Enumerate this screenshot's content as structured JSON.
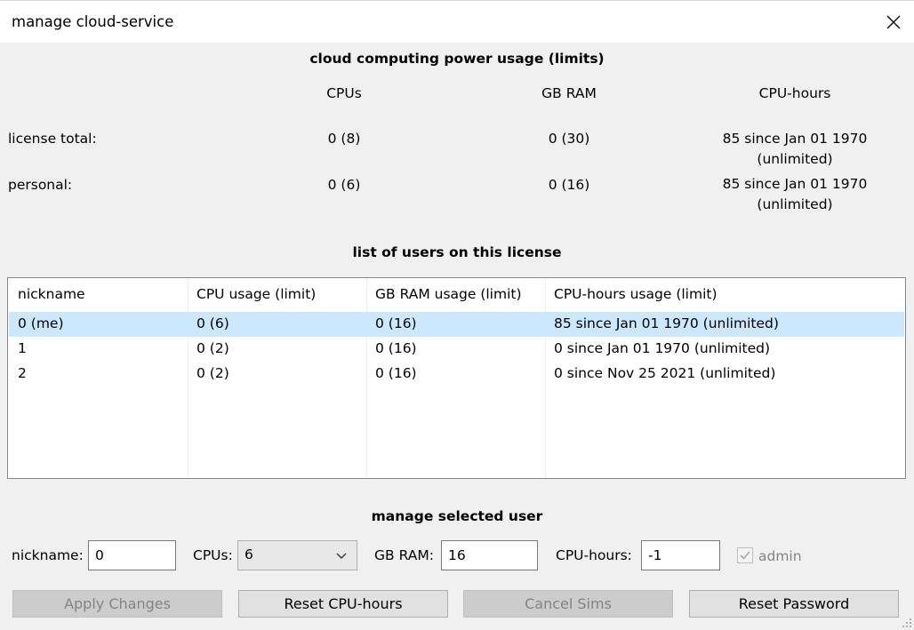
{
  "window": {
    "title": "manage cloud-service",
    "close_icon": "close-icon"
  },
  "usage": {
    "heading": "cloud computing power usage (limits)",
    "columns": {
      "cpus": "CPUs",
      "ram": "GB RAM",
      "hours": "CPU-hours"
    },
    "license_total": {
      "label": "license total:",
      "cpus": "0 (8)",
      "ram": "0 (30)",
      "hours_line1": "85 since Jan 01 1970",
      "hours_line2": "(unlimited)"
    },
    "personal": {
      "label": "personal:",
      "cpus": "0 (6)",
      "ram": "0 (16)",
      "hours_line1": "85 since Jan 01 1970",
      "hours_line2": "(unlimited)"
    }
  },
  "users": {
    "heading": "list of users on this license",
    "headers": [
      "nickname",
      "CPU usage (limit)",
      "GB RAM usage (limit)",
      "CPU-hours usage (limit)"
    ],
    "rows": [
      [
        "0 (me)",
        "0 (6)",
        "0 (16)",
        "85 since Jan 01 1970 (unlimited)"
      ],
      [
        "1",
        "0 (2)",
        "0 (16)",
        "0 since Jan 01 1970 (unlimited)"
      ],
      [
        "2",
        "0 (2)",
        "0 (16)",
        "0 since Nov 25 2021 (unlimited)"
      ]
    ],
    "selected_row": 0
  },
  "manage": {
    "heading": "manage selected user",
    "nickname_label": "nickname:",
    "nickname_value": "0",
    "cpus_label": "CPUs:",
    "cpus_value": "6",
    "ram_label": "GB RAM:",
    "ram_value": "16",
    "hours_label": "CPU-hours:",
    "hours_value": "-1",
    "admin_label": "admin",
    "admin_checked": true
  },
  "buttons": {
    "apply": "Apply Changes",
    "reset_hours": "Reset CPU-hours",
    "cancel_sims": "Cancel Sims",
    "reset_password": "Reset Password"
  },
  "colors": {
    "selection": "#cce8ff",
    "disabled_text": "#838383"
  }
}
